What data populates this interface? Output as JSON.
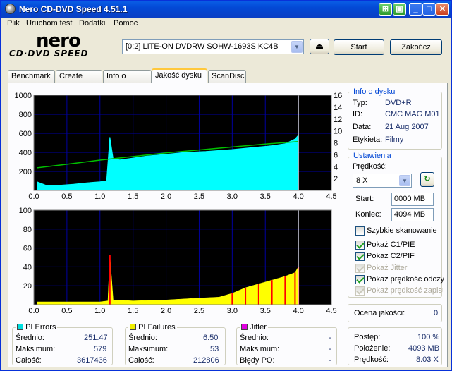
{
  "window": {
    "title": "Nero CD-DVD Speed 4.51.1"
  },
  "menu": [
    "Plik",
    "Uruchom test",
    "Dodatki",
    "Pomoc"
  ],
  "logo": {
    "line1": "nero",
    "line2": "CD·DVD SPEED"
  },
  "drive": {
    "selected": "[0:2]  LITE-ON DVDRW SOHW-1693S KC4B"
  },
  "buttons": {
    "start": "Start",
    "exit": "Zakończ"
  },
  "tabs": [
    {
      "label": "Benchmark",
      "active": false
    },
    {
      "label": "Create Disc",
      "active": false
    },
    {
      "label": "Info o dysku",
      "active": false
    },
    {
      "label": "Jakość dysku",
      "active": true
    },
    {
      "label": "ScanDisc",
      "active": false
    }
  ],
  "disc_info": {
    "title": "Info o dysku",
    "type_label": "Typ:",
    "type": "DVD+R",
    "id_label": "ID:",
    "id": "CMC MAG M01",
    "date_label": "Data:",
    "date": "21 Aug 2007",
    "label_label": "Etykieta:",
    "label": "Filmy"
  },
  "settings": {
    "title": "Ustawienia",
    "speed_label": "Prędkość:",
    "speed": "8 X",
    "start_label": "Start:",
    "start": "0000 MB",
    "end_label": "Koniec:",
    "end": "4094 MB",
    "options": [
      {
        "label": "Szybkie skanowanie",
        "checked": false,
        "enabled": true
      },
      {
        "label": "Pokaż C1/PIE",
        "checked": true,
        "enabled": true
      },
      {
        "label": "Pokaż C2/PIF",
        "checked": true,
        "enabled": true
      },
      {
        "label": "Pokaż Jitter",
        "checked": true,
        "enabled": false
      },
      {
        "label": "Pokaż prędkość odczy",
        "checked": true,
        "enabled": true
      },
      {
        "label": "Pokaż prędkość zapisu",
        "checked": true,
        "enabled": false
      }
    ]
  },
  "quality": {
    "label": "Ocena jakości:",
    "value": "0"
  },
  "progress": {
    "progress_label": "Postęp:",
    "progress": "100 %",
    "position_label": "Położenie:",
    "position": "4093 MB",
    "speed_label": "Prędkość:",
    "speed": "8.03 X"
  },
  "pi_errors": {
    "title": "PI Errors",
    "color": "#00e0e0",
    "avg_label": "Średnio:",
    "avg": "251.47",
    "max_label": "Maksimum:",
    "max": "579",
    "total_label": "Całość:",
    "total": "3617436"
  },
  "pi_failures": {
    "title": "PI Failures",
    "color": "#f0f000",
    "avg_label": "Średnio:",
    "avg": "6.50",
    "max_label": "Maksimum:",
    "max": "53",
    "total_label": "Całość:",
    "total": "212806"
  },
  "jitter": {
    "title": "Jitter",
    "color": "#e000e0",
    "avg_label": "Średnio:",
    "avg": "-",
    "max_label": "Maksimum:",
    "max": "-",
    "po_label": "Błędy PO:",
    "po": "-"
  },
  "chart_data": [
    {
      "type": "area",
      "name": "PI Errors",
      "x_ticks": [
        "0.0",
        "0.5",
        "1.0",
        "1.5",
        "2.0",
        "2.5",
        "3.0",
        "3.5",
        "4.0",
        "4.5"
      ],
      "y_left_ticks": [
        "1000",
        "800",
        "600",
        "400",
        "200"
      ],
      "y_right_ticks": [
        "16",
        "14",
        "12",
        "10",
        "8",
        "6",
        "4",
        "2"
      ],
      "xlim": [
        0,
        4.5
      ],
      "ylim": [
        0,
        1000
      ],
      "y2lim": [
        0,
        16
      ],
      "series": [
        {
          "x": [
            0.05,
            0.2,
            0.4,
            0.6,
            0.8,
            1.0,
            1.1,
            1.15,
            1.2,
            1.3,
            1.5,
            1.7,
            2.0,
            2.3,
            2.6,
            3.0,
            3.3,
            3.6,
            3.8,
            3.95,
            4.0
          ],
          "values": [
            90,
            50,
            55,
            65,
            80,
            90,
            100,
            560,
            330,
            320,
            340,
            360,
            380,
            400,
            410,
            430,
            450,
            470,
            490,
            540,
            580
          ]
        },
        {
          "x": [
            0.05,
            0.5,
            1.0,
            1.5,
            2.0,
            2.5,
            3.0,
            3.5,
            4.0
          ],
          "values": [
            3.8,
            4.4,
            5.1,
            5.7,
            6.3,
            6.8,
            7.3,
            7.8,
            8.2
          ]
        }
      ],
      "colors": [
        "#00ffff",
        "#00c000"
      ]
    },
    {
      "type": "area",
      "name": "PI Failures",
      "x_ticks": [
        "0.0",
        "0.5",
        "1.0",
        "1.5",
        "2.0",
        "2.5",
        "3.0",
        "3.5",
        "4.0",
        "4.5"
      ],
      "y_ticks": [
        "100",
        "80",
        "60",
        "40",
        "20"
      ],
      "xlim": [
        0,
        4.5
      ],
      "ylim": [
        0,
        100
      ],
      "series": [
        {
          "x": [
            0.05,
            0.5,
            1.0,
            1.12,
            1.15,
            1.2,
            1.5,
            2.0,
            2.5,
            2.8,
            3.0,
            3.2,
            3.4,
            3.6,
            3.8,
            3.95,
            4.0
          ],
          "values": [
            3,
            3,
            3,
            4,
            53,
            5,
            4,
            5,
            7,
            8,
            12,
            18,
            22,
            26,
            30,
            34,
            40
          ]
        }
      ],
      "colors": [
        "#ff0000",
        "#ffff00"
      ]
    }
  ],
  "colors": {
    "chart_bg": "#000000",
    "grid": "#0000a0",
    "accent": "#0046d5"
  }
}
